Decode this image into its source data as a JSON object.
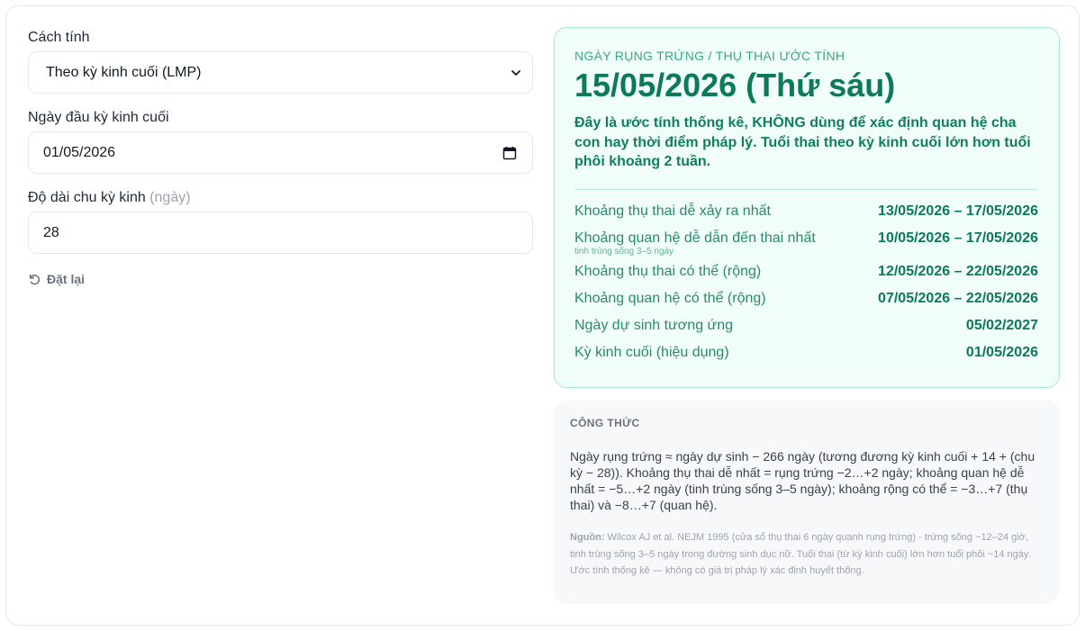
{
  "form": {
    "method_label": "Cách tính",
    "method_value": "Theo kỳ kinh cuối (LMP)",
    "lmp_label": "Ngày đầu kỳ kinh cuối",
    "lmp_value": "01/05/2026",
    "cycle_label": "Độ dài chu kỳ kinh",
    "cycle_unit": "(ngày)",
    "cycle_value": "28",
    "reset_label": "Đặt lại"
  },
  "result": {
    "eyebrow": "NGÀY RỤNG TRỨNG / THỤ THAI ƯỚC TÍNH",
    "date": "15/05/2026 (Thứ sáu)",
    "note": "Đây là ước tính thống kê, KHÔNG dùng để xác định quan hệ cha con hay thời điểm pháp lý. Tuổi thai theo kỳ kinh cuối lớn hơn tuổi phôi khoảng 2 tuần.",
    "rows": [
      {
        "label": "Khoảng thụ thai dễ xảy ra nhất",
        "sub": "",
        "value": "13/05/2026 – 17/05/2026"
      },
      {
        "label": "Khoảng quan hệ dễ dẫn đến thai nhất",
        "sub": "tinh trùng sống 3–5 ngày",
        "value": "10/05/2026 – 17/05/2026"
      },
      {
        "label": "Khoảng thụ thai có thể (rộng)",
        "sub": "",
        "value": "12/05/2026 – 22/05/2026"
      },
      {
        "label": "Khoảng quan hệ có thể (rộng)",
        "sub": "",
        "value": "07/05/2026 – 22/05/2026"
      },
      {
        "label": "Ngày dự sinh tương ứng",
        "sub": "",
        "value": "05/02/2027"
      },
      {
        "label": "Kỳ kinh cuối (hiệu dụng)",
        "sub": "",
        "value": "01/05/2026"
      }
    ]
  },
  "formula": {
    "heading": "CÔNG THỨC",
    "body": "Ngày rụng trứng ≈ ngày dự sinh − 266 ngày (tương đương kỳ kinh cuối + 14 + (chu kỳ − 28)). Khoảng thụ thai dễ nhất = rụng trứng −2…+2 ngày; khoảng quan hệ dễ nhất = −5…+2 ngày (tinh trùng sống 3–5 ngày); khoảng rộng có thể = −3…+7 (thụ thai) và −8…+7 (quan hệ).",
    "source_label": "Nguồn:",
    "source_text": " Wilcox AJ et al. NEJM 1995 (cửa sổ thụ thai 6 ngày quanh rụng trứng) · trứng sống ~12–24 giờ, tinh trùng sống 3–5 ngày trong đường sinh dục nữ. Tuổi thai (từ kỳ kinh cuối) lớn hơn tuổi phôi ~14 ngày. Ước tính thống kê — không có giá trị pháp lý xác định huyết thống."
  },
  "colors": {
    "accent": "#0c7a5a",
    "result_bg": "#f0fdf8",
    "result_border": "#a7e9d2",
    "formula_bg": "#f7f8fa"
  },
  "icons": {
    "select": "chevron-down-icon",
    "date": "calendar-icon",
    "reset": "reset-icon"
  }
}
